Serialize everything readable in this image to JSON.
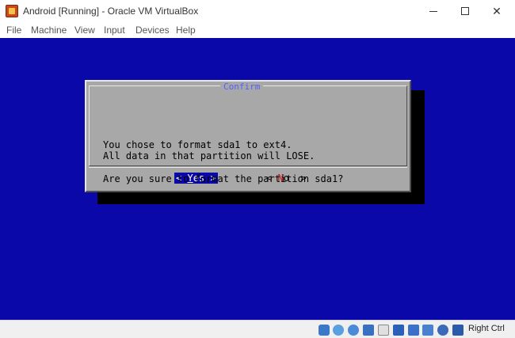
{
  "window": {
    "title": "Android [Running] - Oracle VM VirtualBox",
    "minimize_label": "—",
    "close_label": "✕"
  },
  "menu": [
    "File",
    "Machine",
    "View",
    "Input",
    "Devices",
    "Help"
  ],
  "dialog": {
    "title": "Confirm",
    "line1": "You chose to format sda1 to ext4.",
    "line2": "All data in that partition will LOSE.",
    "question": "Are you sure to format the partition sda1?",
    "yes_open": "< ",
    "yes_hot": "Y",
    "yes_rest": "es >",
    "no_open": "< ",
    "no_hot": "N",
    "no_rest": "o  >"
  },
  "statusbar": {
    "icons": [
      "hard-disk-icon",
      "optical-drive-icon",
      "audio-icon",
      "network-icon",
      "usb-icon",
      "shared-folders-icon",
      "display-icon",
      "video-capture-icon",
      "cpu-icon",
      "mouse-integration-icon",
      "keyboard-icon"
    ],
    "host_key": "Right Ctrl"
  },
  "colors": {
    "guest_background": "#0a08a8",
    "dialog_background": "#a8a8a8",
    "dialog_title": "#5060ff",
    "hotkey_red": "#c01010"
  }
}
